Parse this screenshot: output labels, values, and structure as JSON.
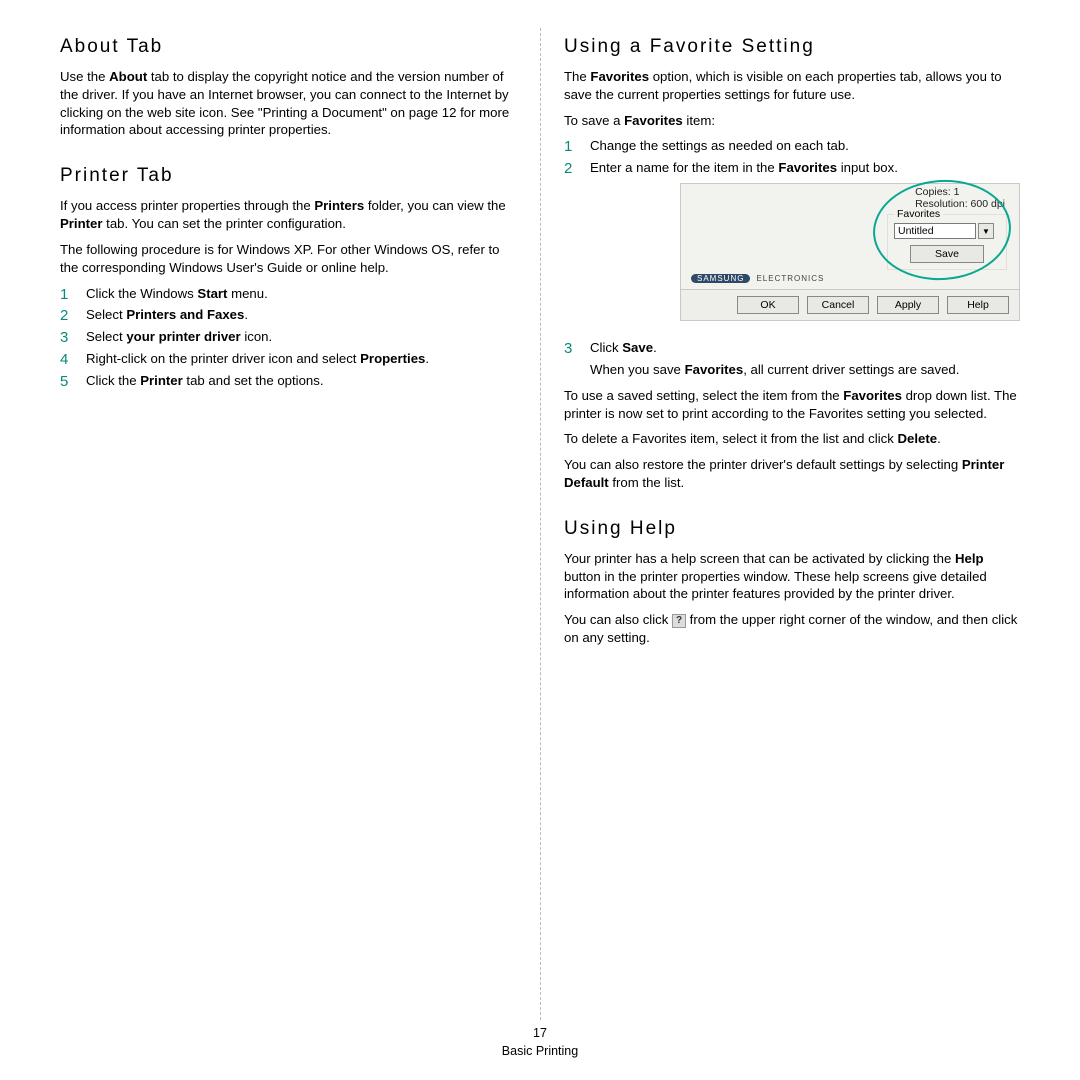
{
  "left": {
    "about_h": "About Tab",
    "about_p": "Use the <b>About</b> tab to display the copyright notice and the version number of the driver. If you have an Internet browser, you can connect to the Internet by clicking on the web site icon. See \"Printing a Document\" on page 12 for more information about accessing printer properties.",
    "printer_h": "Printer Tab",
    "printer_p1": "If you access printer properties through the <b>Printers</b> folder, you can view the <b>Printer</b> tab. You can set the printer configuration.",
    "printer_p2": "The following procedure is for Windows XP. For other Windows OS, refer to the corresponding Windows User's Guide or online help.",
    "printer_steps": [
      "Click the Windows <b>Start</b> menu.",
      "Select <b>Printers and Faxes</b>.",
      "Select <b>your printer driver</b> icon.",
      "Right-click on the printer driver icon and select <b>Properties</b>.",
      "Click the <b>Printer</b> tab and set the options."
    ]
  },
  "right": {
    "fav_h": "Using a Favorite Setting",
    "fav_p1": "The <b>Favorites</b> option, which is visible on each properties tab, allows you to save the current properties settings for future use.",
    "fav_p2": "To save a <b>Favorites</b> item:",
    "fav_steps_a": [
      "Change the settings as needed on each tab.",
      "Enter a name for the item in the <b>Favorites</b> input box."
    ],
    "fav_step3_label": "Click <b>Save</b>.",
    "fav_step3_note": "When you save <b>Favorites</b>, all current driver settings are saved.",
    "fav_p3": "To use a saved setting, select the item from the <b>Favorites</b> drop down list. The printer is now set to print according to the Favorites setting you selected.",
    "fav_p4": "To delete a Favorites item, select it from the list and click <b>Delete</b>.",
    "fav_p5": "You can also restore the printer driver's default settings by selecting <b>Printer Default</b> from the list.",
    "help_h": "Using Help",
    "help_p1": "Your printer has a help screen that can be activated by clicking the <b>Help</b> button in the printer properties window. These help screens give detailed information about the printer features provided by the printer driver.",
    "help_p2_a": "You can also click ",
    "help_p2_b": " from the upper right corner of the window, and then click on any setting."
  },
  "dialog": {
    "copies_label": "Copies: 1",
    "resolution_label": "Resolution: 600 dpi",
    "fav_legend": "Favorites",
    "fav_value": "Untitled",
    "save": "Save",
    "brand": "SAMSUNG",
    "brand_sub": "ELECTRONICS",
    "ok": "OK",
    "cancel": "Cancel",
    "apply": "Apply",
    "help": "Help"
  },
  "footer_page": "17",
  "footer_title": "Basic Printing"
}
